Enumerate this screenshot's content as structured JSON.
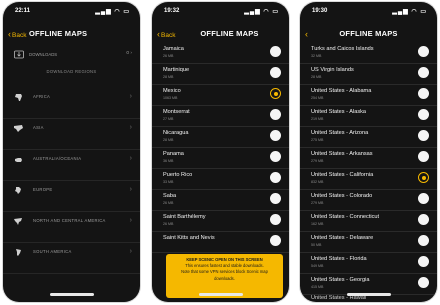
{
  "colors": {
    "accent": "#f5b800",
    "background": "#141414",
    "text": "#f4f4f4"
  },
  "screen1": {
    "status_time": "22:11",
    "back_label": "Back",
    "title": "OFFLINE MAPS",
    "downloads_label": "DOWNLOADS",
    "downloads_value": "0",
    "section_label": "DOWNLOAD REGIONS",
    "regions": [
      {
        "label": "AFRICA",
        "icon": "africa-icon"
      },
      {
        "label": "ASIA",
        "icon": "asia-icon"
      },
      {
        "label": "AUSTRALIA/OCEANIA",
        "icon": "australia-icon"
      },
      {
        "label": "EUROPE",
        "icon": "europe-icon"
      },
      {
        "label": "NORTH AND CENTRAL AMERICA",
        "icon": "north-america-icon"
      },
      {
        "label": "SOUTH AMERICA",
        "icon": "south-america-icon"
      }
    ]
  },
  "screen2": {
    "status_time": "19:32",
    "back_label": "Back",
    "title": "OFFLINE MAPS",
    "items": [
      {
        "name": "Jamaica",
        "size": "26 MB",
        "selected": false
      },
      {
        "name": "Martinique",
        "size": "28 MB",
        "selected": false
      },
      {
        "name": "Mexico",
        "size": "1063 MB",
        "selected": true
      },
      {
        "name": "Montserrat",
        "size": "27 MB",
        "selected": false
      },
      {
        "name": "Nicaragua",
        "size": "28 MB",
        "selected": false
      },
      {
        "name": "Panama",
        "size": "36 MB",
        "selected": false
      },
      {
        "name": "Puerto Rico",
        "size": "33 MB",
        "selected": false
      },
      {
        "name": "Saba",
        "size": "26 MB",
        "selected": false
      },
      {
        "name": "Saint Barthélemy",
        "size": "26 MB",
        "selected": false
      },
      {
        "name": "Saint Kitts and Nevis",
        "size": "",
        "selected": false
      }
    ],
    "banner_line1": "KEEP SCENIC OPEN ON THIS SCREEN",
    "banner_line2": "This ensures fastest and stable downloads.",
    "banner_line3": "Note that some VPN services block Scenic map",
    "banner_line4": "downloads."
  },
  "screen3": {
    "status_time": "19:30",
    "title": "OFFLINE MAPS",
    "items": [
      {
        "name": "Turks and Caicos Islands",
        "size": "32 MB",
        "selected": false
      },
      {
        "name": "US Virgin Islands",
        "size": "28 MB",
        "selected": false
      },
      {
        "name": "United States - Alabama",
        "size": "254 MB",
        "selected": false
      },
      {
        "name": "United States - Alaska",
        "size": "219 MB",
        "selected": false
      },
      {
        "name": "United States - Arizona",
        "size": "275 MB",
        "selected": false
      },
      {
        "name": "United States - Arkansas",
        "size": "279 MB",
        "selected": false
      },
      {
        "name": "United States - California",
        "size": "832 MB",
        "selected": true
      },
      {
        "name": "United States - Colorado",
        "size": "279 MB",
        "selected": false
      },
      {
        "name": "United States - Connecticut",
        "size": "162 MB",
        "selected": false
      },
      {
        "name": "United States - Delaware",
        "size": "50 MB",
        "selected": false
      },
      {
        "name": "United States - Florida",
        "size": "549 MB",
        "selected": false
      },
      {
        "name": "United States - Georgia",
        "size": "415 MB",
        "selected": false
      }
    ],
    "partial_item": "United States - Hawaii"
  }
}
